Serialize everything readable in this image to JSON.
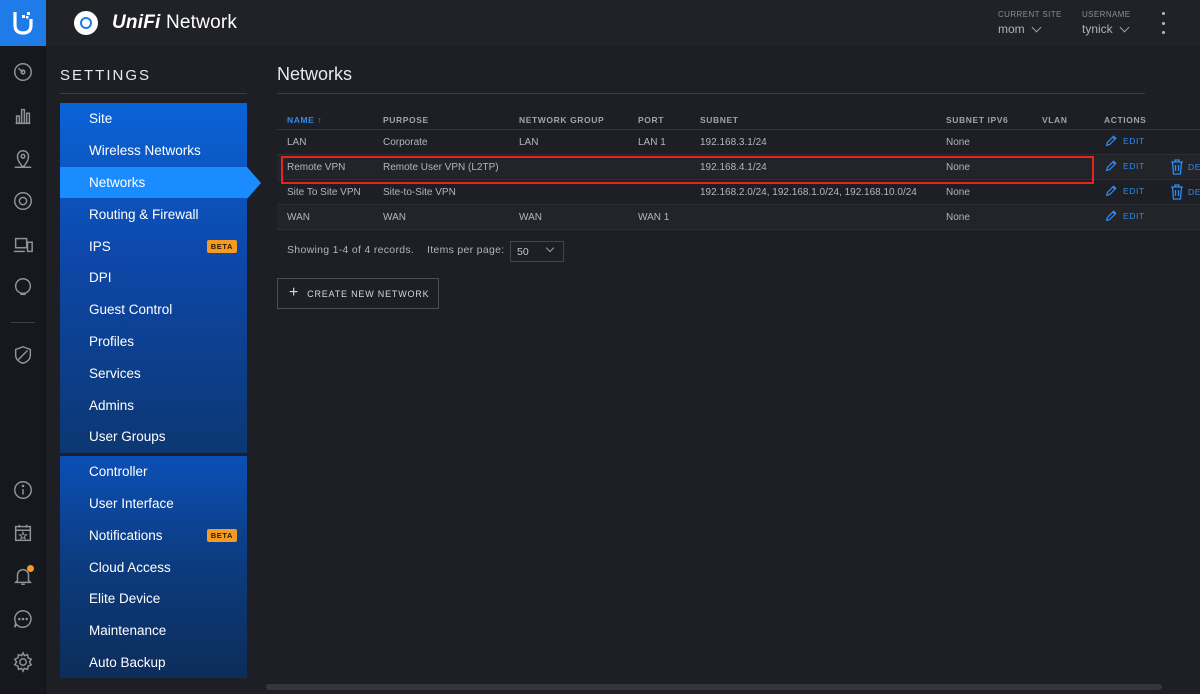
{
  "header": {
    "app_title_brand": "UniFi",
    "app_title_product": " Network",
    "current_site_label": "CURRENT SITE",
    "current_site_value": "mom",
    "username_label": "USERNAME",
    "username_value": "tynick"
  },
  "sidebar": {
    "title": "SETTINGS",
    "group1": [
      {
        "label": "Site"
      },
      {
        "label": "Wireless Networks"
      },
      {
        "label": "Networks",
        "active": true
      },
      {
        "label": "Routing & Firewall"
      },
      {
        "label": "IPS",
        "badge": "BETA"
      },
      {
        "label": "DPI"
      },
      {
        "label": "Guest Control"
      },
      {
        "label": "Profiles"
      },
      {
        "label": "Services"
      },
      {
        "label": "Admins"
      },
      {
        "label": "User Groups"
      }
    ],
    "group2": [
      {
        "label": "Controller"
      },
      {
        "label": "User Interface"
      },
      {
        "label": "Notifications",
        "badge": "BETA"
      },
      {
        "label": "Cloud Access"
      },
      {
        "label": "Elite Device"
      },
      {
        "label": "Maintenance"
      },
      {
        "label": "Auto Backup"
      }
    ]
  },
  "main": {
    "page_title": "Networks",
    "table": {
      "columns": [
        "NAME ↑",
        "PURPOSE",
        "NETWORK GROUP",
        "PORT",
        "SUBNET",
        "SUBNET IPV6",
        "VLAN",
        "ACTIONS"
      ],
      "rows": [
        {
          "name": "LAN",
          "purpose": "Corporate",
          "group": "LAN",
          "port": "LAN 1",
          "subnet": "192.168.3.1/24",
          "ipv6": "None",
          "vlan": "",
          "edit": "EDIT",
          "delete": ""
        },
        {
          "name": "Remote VPN",
          "purpose": "Remote User VPN (L2TP)",
          "group": "",
          "port": "",
          "subnet": "192.168.4.1/24",
          "ipv6": "None",
          "vlan": "",
          "edit": "EDIT",
          "delete": "DE"
        },
        {
          "name": "Site To Site VPN",
          "purpose": "Site-to-Site VPN",
          "group": "",
          "port": "",
          "subnet": "192.168.2.0/24, 192.168.1.0/24, 192.168.10.0/24",
          "ipv6": "None",
          "vlan": "",
          "edit": "EDIT",
          "delete": "DE"
        },
        {
          "name": "WAN",
          "purpose": "WAN",
          "group": "WAN",
          "port": "WAN 1",
          "subnet": "",
          "ipv6": "None",
          "vlan": "",
          "edit": "EDIT",
          "delete": ""
        }
      ]
    },
    "records_info": "Showing 1-4 of 4 records.",
    "items_per_page_label": "Items per page:",
    "items_per_page_value": "50",
    "create_button": "CREATE NEW NETWORK"
  },
  "colors": {
    "accent": "#1a8cff",
    "highlight": "#e0281f",
    "beta_badge": "#f59a23"
  },
  "icons": [
    "unifi-logo",
    "dashboard-icon",
    "statistics-icon",
    "map-icon",
    "devices-icon",
    "clients-icon",
    "insights-icon",
    "threat-management-icon",
    "info-icon",
    "events-icon",
    "alerts-icon",
    "chat-icon",
    "settings-icon"
  ]
}
